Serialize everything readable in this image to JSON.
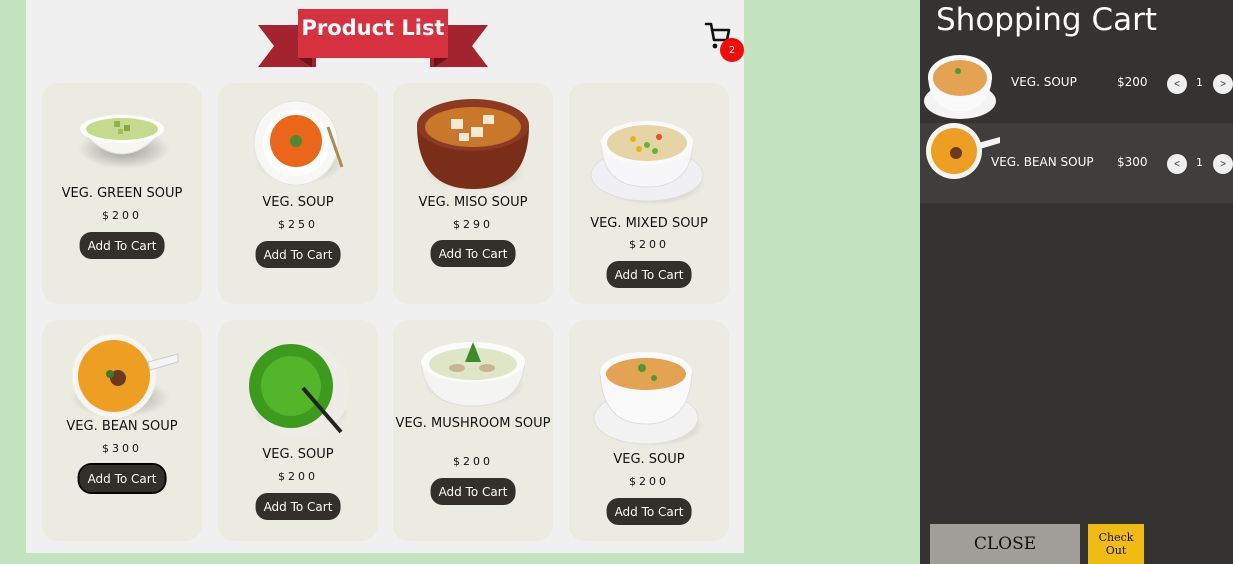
{
  "header": {
    "title": "Product List",
    "cart_count": "2"
  },
  "products": [
    {
      "name": "VEG. GREEN SOUP",
      "price": "$200",
      "button": "Add To Cart"
    },
    {
      "name": "VEG. SOUP",
      "price": "$250",
      "button": "Add To Cart"
    },
    {
      "name": "VEG. MISO SOUP",
      "price": "$290",
      "button": "Add To Cart"
    },
    {
      "name": "VEG. MIXED SOUP",
      "price": "$200",
      "button": "Add To Cart"
    },
    {
      "name": "VEG. BEAN SOUP",
      "price": "$300",
      "button": "Add To Cart"
    },
    {
      "name": "VEG. SOUP",
      "price": "$200",
      "button": "Add To Cart"
    },
    {
      "name": "VEG. MUSHROOM SOUP",
      "price": "$200",
      "button": "Add To Cart"
    },
    {
      "name": "VEG. SOUP",
      "price": "$200",
      "button": "Add To Cart"
    }
  ],
  "cart": {
    "title": "Shopping Cart",
    "items": [
      {
        "name": "VEG. SOUP",
        "price": "$200",
        "qty": "1",
        "dec": "<",
        "inc": ">"
      },
      {
        "name": "VEG. BEAN SOUP",
        "price": "$300",
        "qty": "1",
        "dec": "<",
        "inc": ">"
      }
    ],
    "close_label": "CLOSE",
    "checkout_label": "Check Out"
  },
  "colors": {
    "page_bg": "#c4e3c1",
    "ribbon": "#d6313f",
    "card_bg": "#ebebe2",
    "button_bg": "#332f2b",
    "drawer_bg": "#343331",
    "badge": "#f40a0a",
    "checkout": "#f0bb12"
  },
  "icons": [
    "cart-icon",
    "soup-bowl-image"
  ]
}
